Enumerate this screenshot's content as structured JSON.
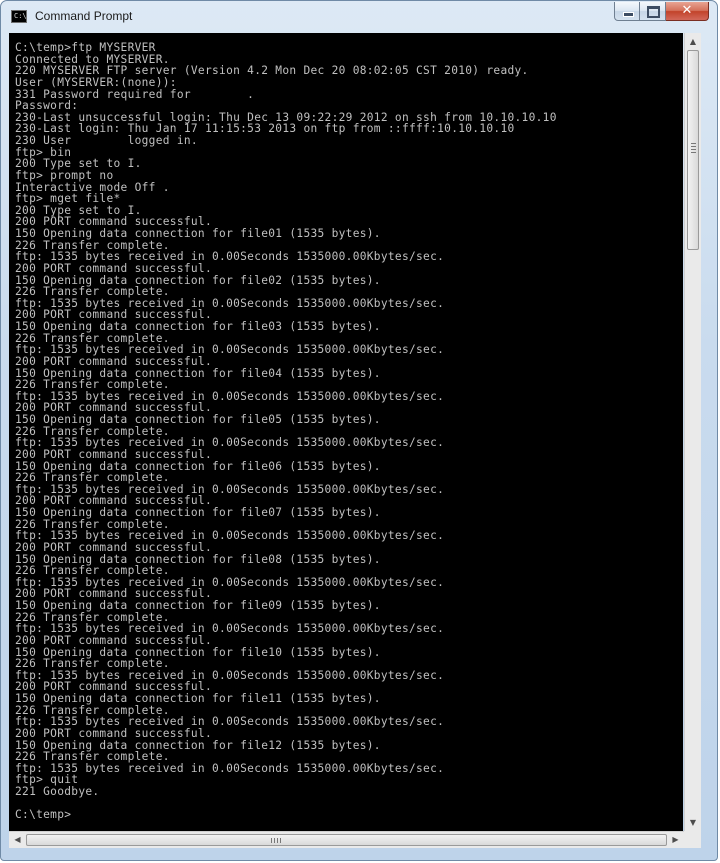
{
  "window": {
    "title": "Command Prompt",
    "icon_label": "C:\\",
    "icon": "command-prompt-icon",
    "minimize_glyph": "",
    "maximize_glyph": "",
    "close_glyph": "✕"
  },
  "console": {
    "text_color": "#c0c0c0",
    "background": "#000000",
    "lines": [
      "C:\\temp>ftp MYSERVER",
      "Connected to MYSERVER.",
      "220 MYSERVER FTP server (Version 4.2 Mon Dec 20 08:02:05 CST 2010) ready.",
      "User (MYSERVER:(none)):",
      "331 Password required for        .",
      "Password:",
      "230-Last unsuccessful login: Thu Dec 13 09:22:29 2012 on ssh from 10.10.10.10",
      "230-Last login: Thu Jan 17 11:15:53 2013 on ftp from ::ffff:10.10.10.10",
      "230 User        logged in.",
      "ftp> bin",
      "200 Type set to I.",
      "ftp> prompt no",
      "Interactive mode Off .",
      "ftp> mget file*",
      "200 Type set to I.",
      "200 PORT command successful.",
      "150 Opening data connection for file01 (1535 bytes).",
      "226 Transfer complete.",
      "ftp: 1535 bytes received in 0.00Seconds 1535000.00Kbytes/sec.",
      "200 PORT command successful.",
      "150 Opening data connection for file02 (1535 bytes).",
      "226 Transfer complete.",
      "ftp: 1535 bytes received in 0.00Seconds 1535000.00Kbytes/sec.",
      "200 PORT command successful.",
      "150 Opening data connection for file03 (1535 bytes).",
      "226 Transfer complete.",
      "ftp: 1535 bytes received in 0.00Seconds 1535000.00Kbytes/sec.",
      "200 PORT command successful.",
      "150 Opening data connection for file04 (1535 bytes).",
      "226 Transfer complete.",
      "ftp: 1535 bytes received in 0.00Seconds 1535000.00Kbytes/sec.",
      "200 PORT command successful.",
      "150 Opening data connection for file05 (1535 bytes).",
      "226 Transfer complete.",
      "ftp: 1535 bytes received in 0.00Seconds 1535000.00Kbytes/sec.",
      "200 PORT command successful.",
      "150 Opening data connection for file06 (1535 bytes).",
      "226 Transfer complete.",
      "ftp: 1535 bytes received in 0.00Seconds 1535000.00Kbytes/sec.",
      "200 PORT command successful.",
      "150 Opening data connection for file07 (1535 bytes).",
      "226 Transfer complete.",
      "ftp: 1535 bytes received in 0.00Seconds 1535000.00Kbytes/sec.",
      "200 PORT command successful.",
      "150 Opening data connection for file08 (1535 bytes).",
      "226 Transfer complete.",
      "ftp: 1535 bytes received in 0.00Seconds 1535000.00Kbytes/sec.",
      "200 PORT command successful.",
      "150 Opening data connection for file09 (1535 bytes).",
      "226 Transfer complete.",
      "ftp: 1535 bytes received in 0.00Seconds 1535000.00Kbytes/sec.",
      "200 PORT command successful.",
      "150 Opening data connection for file10 (1535 bytes).",
      "226 Transfer complete.",
      "ftp: 1535 bytes received in 0.00Seconds 1535000.00Kbytes/sec.",
      "200 PORT command successful.",
      "150 Opening data connection for file11 (1535 bytes).",
      "226 Transfer complete.",
      "ftp: 1535 bytes received in 0.00Seconds 1535000.00Kbytes/sec.",
      "200 PORT command successful.",
      "150 Opening data connection for file12 (1535 bytes).",
      "226 Transfer complete.",
      "ftp: 1535 bytes received in 0.00Seconds 1535000.00Kbytes/sec.",
      "ftp> quit",
      "221 Goodbye.",
      "",
      "C:\\temp>"
    ]
  },
  "scrollbars": {
    "up_arrow": "▲",
    "down_arrow": "▼",
    "left_arrow": "◀",
    "right_arrow": "▶"
  }
}
